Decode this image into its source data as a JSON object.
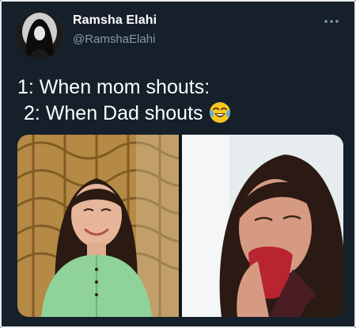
{
  "tweet": {
    "display_name": "Ramsha Elahi",
    "handle": "@RamshaElahi",
    "text_line1": "1: When mom shouts:",
    "text_line2": "2: When Dad shouts",
    "emoji": "face-with-tears-of-joy-icon"
  },
  "media": {
    "images": [
      "smiling-woman-photo",
      "crying-woman-photo"
    ]
  },
  "colors": {
    "background": "#15202b",
    "name": "#ffffff",
    "handle": "#8899a6",
    "text": "#ffffff"
  }
}
